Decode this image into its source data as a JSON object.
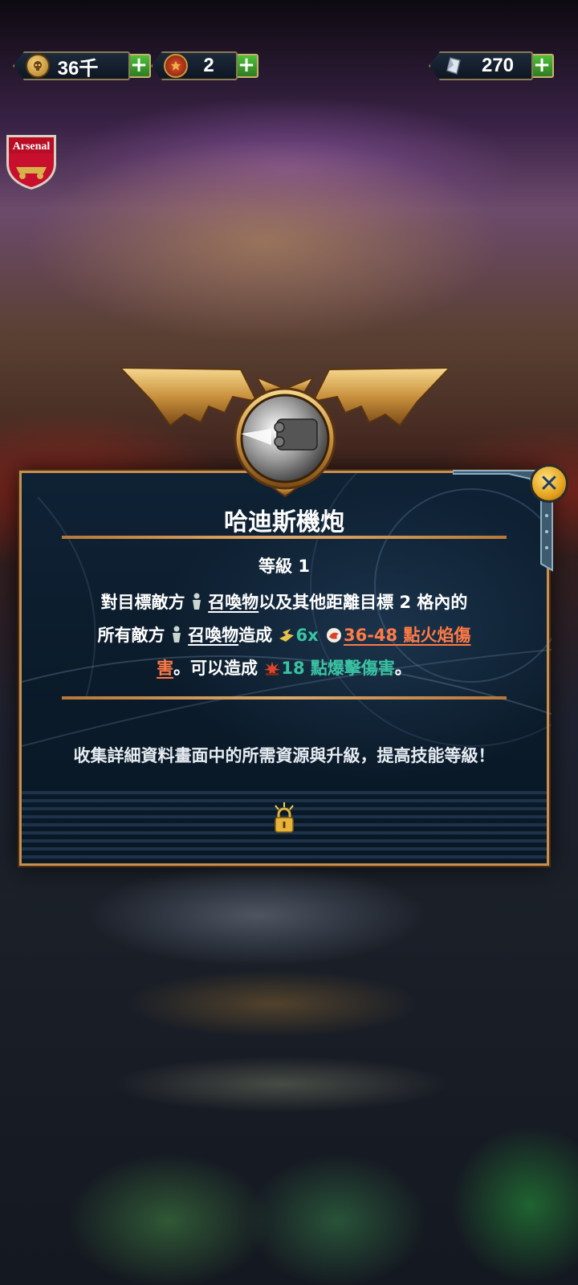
{
  "currencies": [
    {
      "icon": "skull-coin-icon",
      "value": "36千"
    },
    {
      "icon": "medal-icon",
      "value": "2"
    },
    {
      "icon": "crystal-icon",
      "value": "270"
    }
  ],
  "badge_text": "Arsenal",
  "dialog": {
    "title": "哈迪斯機炮",
    "level": "等級 1",
    "desc": {
      "line1_a": "對目標敵方 ",
      "summon1": "召喚物",
      "line1_b": "以及其他距離目標 2 格內的",
      "line2_a": "所有敵方 ",
      "summon2": "召喚物",
      "line2_b": "造成 ",
      "hits": "6x",
      "fire_damage_a": "36-48 點火焰傷",
      "fire_damage_b": "害",
      "line3_a": "。可以造成 ",
      "blast_damage": "18 點爆擊傷害",
      "line3_b": "。"
    },
    "hint": "收集詳細資料畫面中的所需資源與升級，提高技能等級！",
    "close_label": "✕"
  },
  "colors": {
    "frame": "#c89050",
    "teal": "#39c3a3",
    "orange": "#ff7a45"
  }
}
